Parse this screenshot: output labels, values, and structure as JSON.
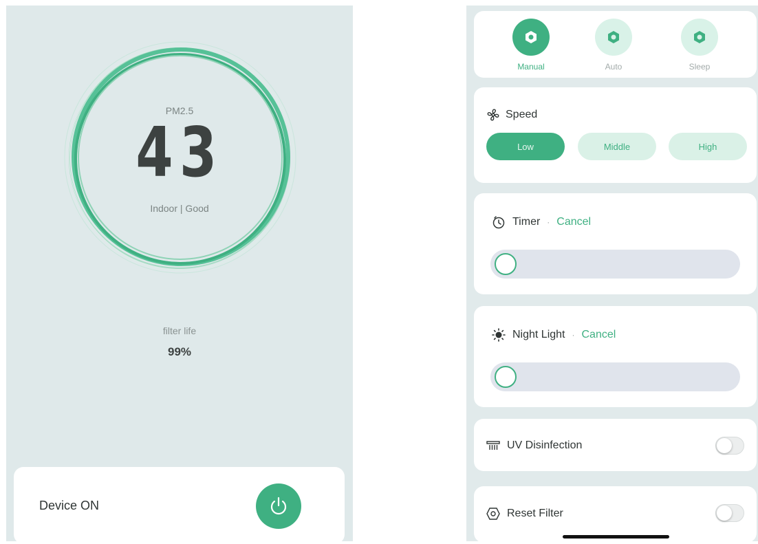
{
  "colors": {
    "accent": "#3fb082",
    "accent_light": "#d9f2e8",
    "panel_bg": "#dfe9ea"
  },
  "air_quality": {
    "pm_label": "PM2.5",
    "pm_value": "43",
    "status": "Indoor | Good",
    "filter_label": "filter life",
    "filter_value": "99%"
  },
  "device": {
    "label": "Device ON",
    "power_icon": "power-icon"
  },
  "modes": [
    {
      "label": "Manual",
      "icon": "nut-icon",
      "active": true
    },
    {
      "label": "Auto",
      "icon": "nut-icon",
      "active": false
    },
    {
      "label": "Sleep",
      "icon": "nut-icon",
      "active": false
    }
  ],
  "speed": {
    "title": "Speed",
    "icon": "fan-icon",
    "options": [
      {
        "label": "Low",
        "active": true
      },
      {
        "label": "Middle",
        "active": false
      },
      {
        "label": "High",
        "active": false
      }
    ]
  },
  "timer": {
    "title": "Timer",
    "separator": "·",
    "cancel": "Cancel",
    "icon": "timer-icon",
    "slider_level": 0
  },
  "night_light": {
    "title": "Night Light",
    "separator": "·",
    "cancel": "Cancel",
    "icon": "sun-icon",
    "slider_level": 0
  },
  "uv": {
    "title": "UV Disinfection",
    "icon": "uv-lamp-icon",
    "enabled": false
  },
  "reset_filter": {
    "title": "Reset Filter",
    "icon": "filter-icon",
    "enabled": false
  }
}
